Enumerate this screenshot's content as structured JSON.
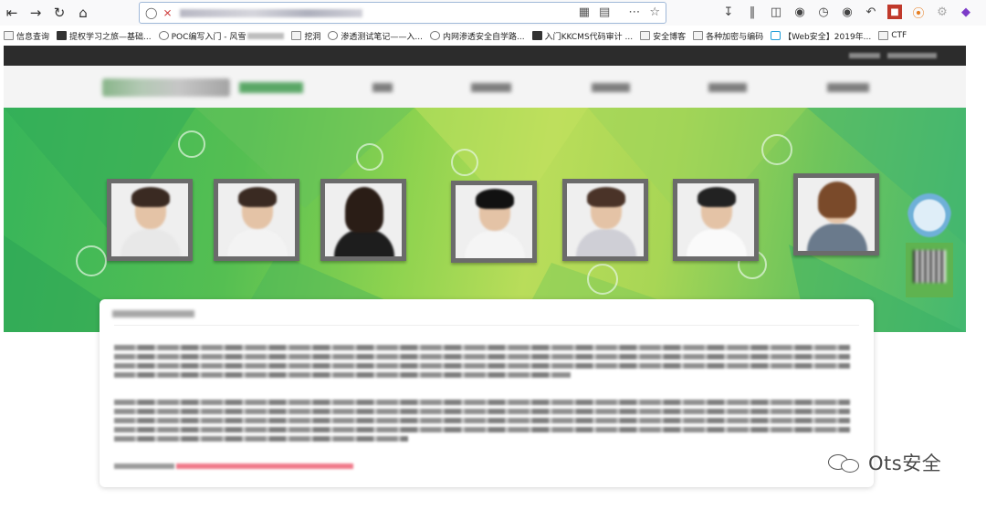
{
  "browser": {
    "toolbar_icons": [
      "back-icon",
      "forward-icon",
      "reload-icon",
      "home-icon"
    ],
    "url_icons": [
      "qr-code-icon",
      "reader-icon",
      "more-icon",
      "bookmark-star-icon"
    ],
    "right_icons": [
      "download-icon",
      "library-icon",
      "sidebar-icon",
      "account-icon",
      "history-icon",
      "chat-icon",
      "undo-icon",
      "extension-red-icon",
      "extension-orange-icon",
      "settings-icon",
      "extension-purple-icon"
    ]
  },
  "bookmarks": [
    {
      "label": "信息查询",
      "icon": "folder"
    },
    {
      "label": "提权学习之旅—基础...",
      "icon": "dark"
    },
    {
      "label": "POC编写入门 - 风雪",
      "icon": "circle"
    },
    {
      "label": "挖洞",
      "icon": "folder"
    },
    {
      "label": "渗透测试笔记——入...",
      "icon": "circle"
    },
    {
      "label": "内网渗透安全自学路...",
      "icon": "circle"
    },
    {
      "label": "入门KKCMS代码审计 ...",
      "icon": "dark"
    },
    {
      "label": "安全博客",
      "icon": "folder"
    },
    {
      "label": "各种加密与编码",
      "icon": "folder"
    },
    {
      "label": "【Web安全】2019年...",
      "icon": "blue"
    },
    {
      "label": "CTF",
      "icon": "folder"
    }
  ],
  "watermark": {
    "text": "Ots安全"
  },
  "colors": {
    "banner_green": "#4cb85a",
    "top_bar": "#2c2c2c",
    "accent_red": "#f07a8a"
  }
}
